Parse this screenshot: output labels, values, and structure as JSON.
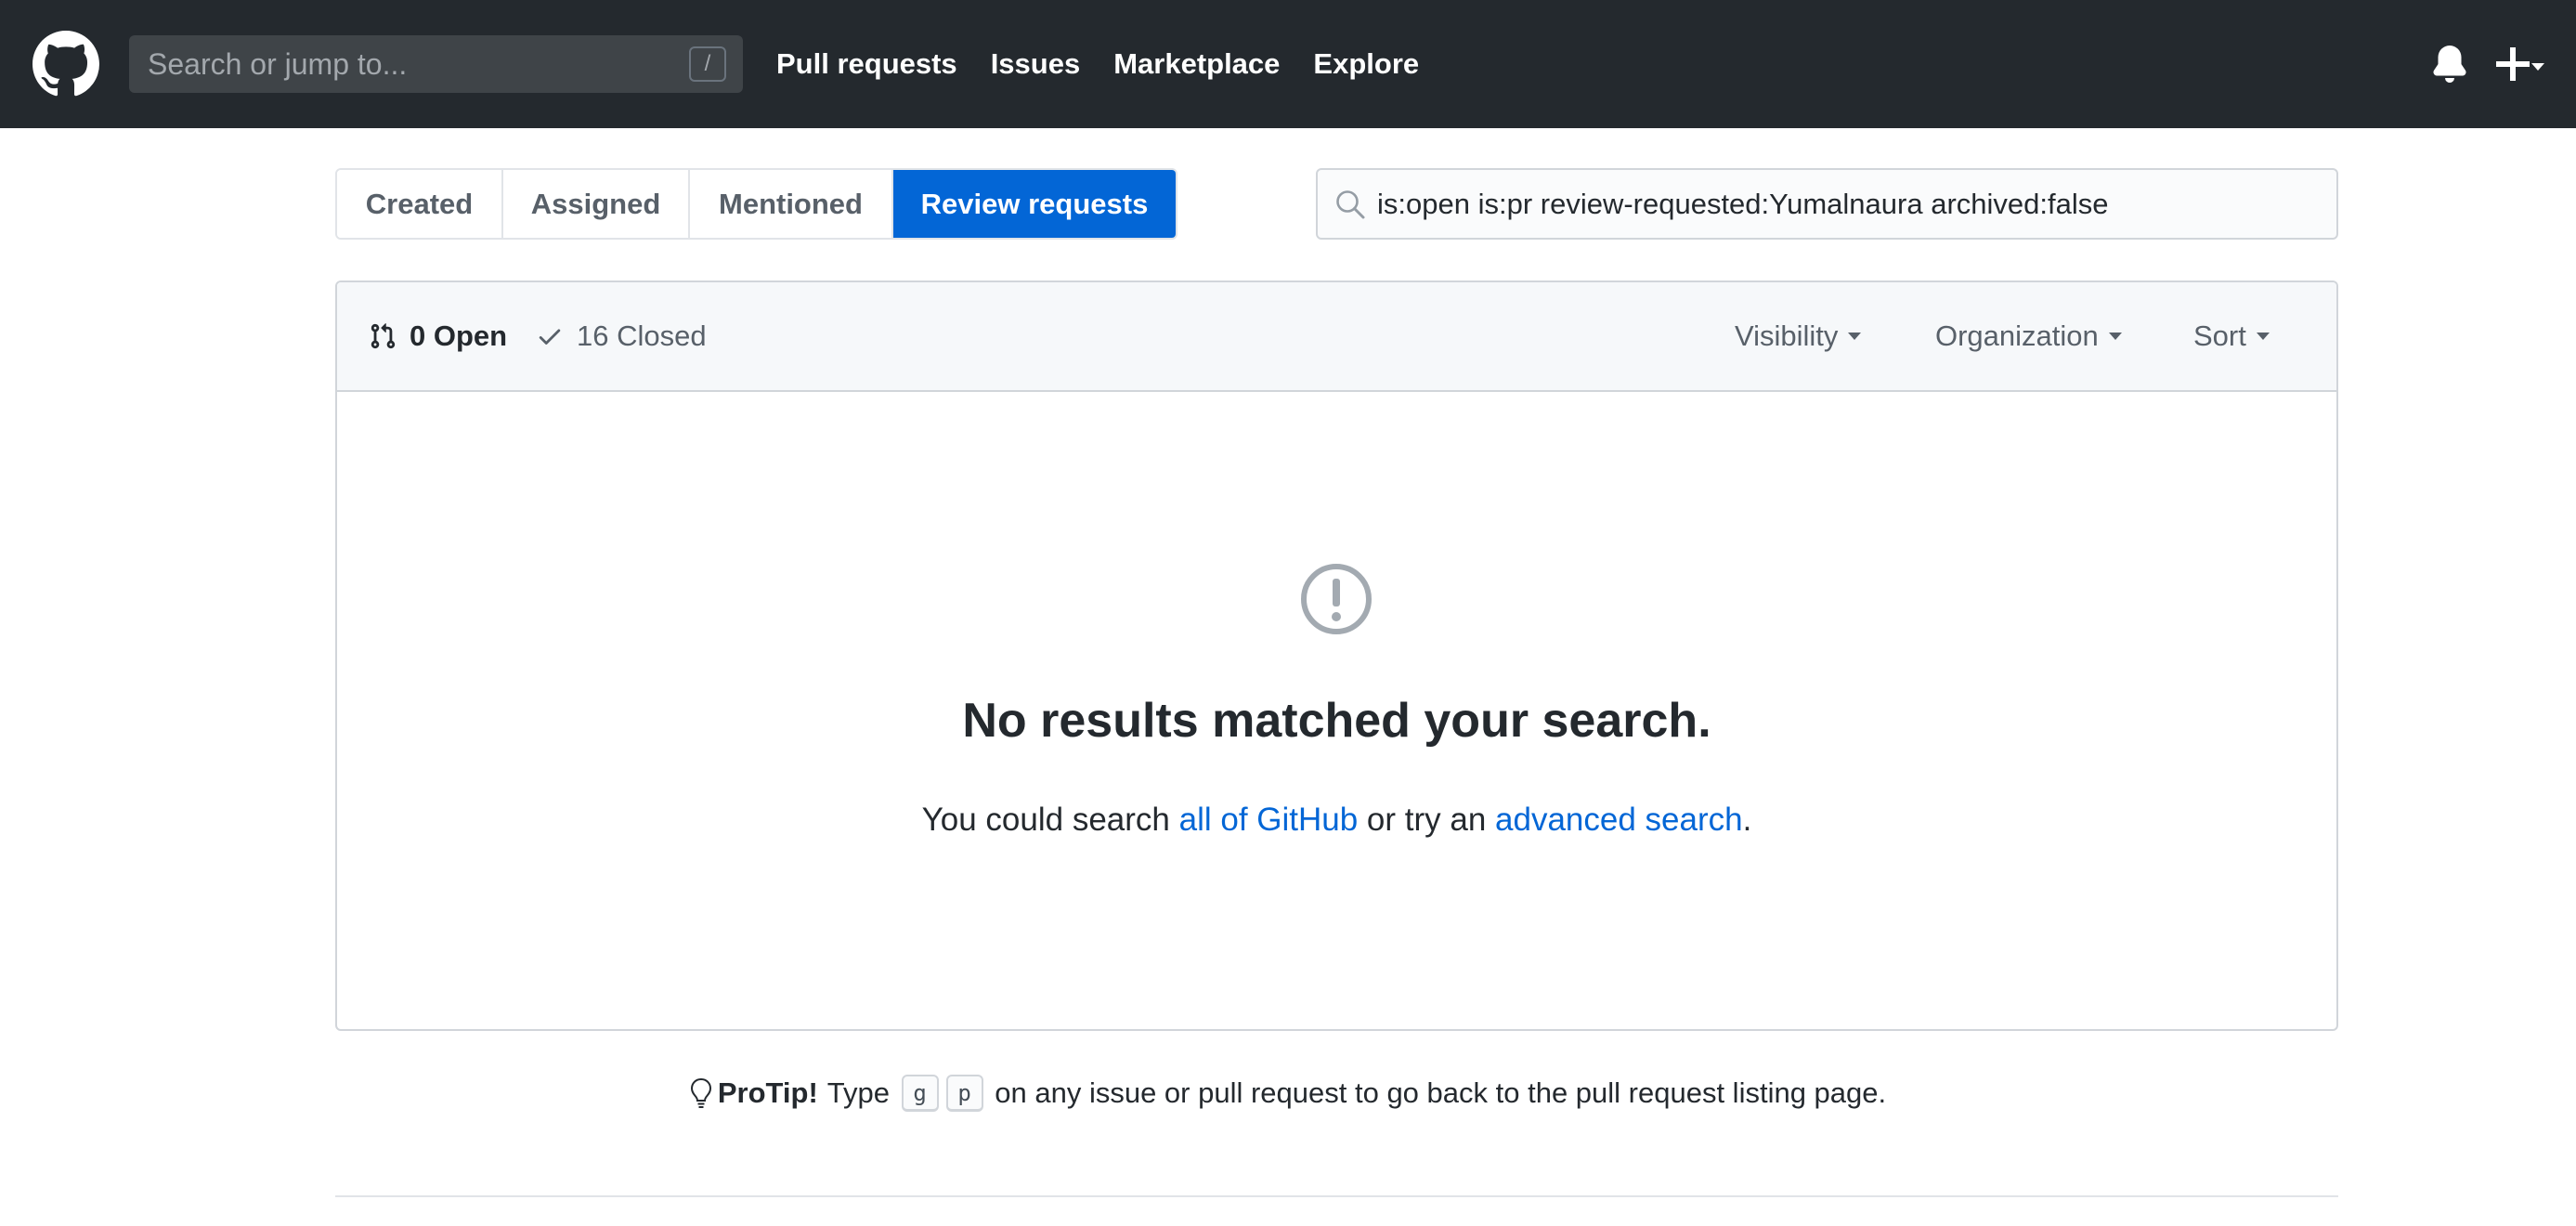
{
  "header": {
    "search_placeholder": "Search or jump to...",
    "slash_hint": "/",
    "nav": [
      "Pull requests",
      "Issues",
      "Marketplace",
      "Explore"
    ]
  },
  "tabs": [
    "Created",
    "Assigned",
    "Mentioned",
    "Review requests"
  ],
  "selected_tab": "Review requests",
  "filter_query": "is:open is:pr review-requested:Yumalnaura archived:false",
  "results": {
    "open_label": "0 Open",
    "closed_label": "16 Closed",
    "filters": [
      "Visibility",
      "Organization",
      "Sort"
    ],
    "blank_title": "No results matched your search.",
    "blank_prefix": "You could search ",
    "blank_link1": "all of GitHub",
    "blank_middle": " or try an ",
    "blank_link2": "advanced search",
    "blank_suffix": "."
  },
  "protip": {
    "label": "ProTip!",
    "before": "Type",
    "key1": "g",
    "key2": "p",
    "after": "on any issue or pull request to go back to the pull request listing page."
  },
  "colors": {
    "header_bg": "#24292e",
    "accent": "#0366d6",
    "muted": "#586069"
  }
}
